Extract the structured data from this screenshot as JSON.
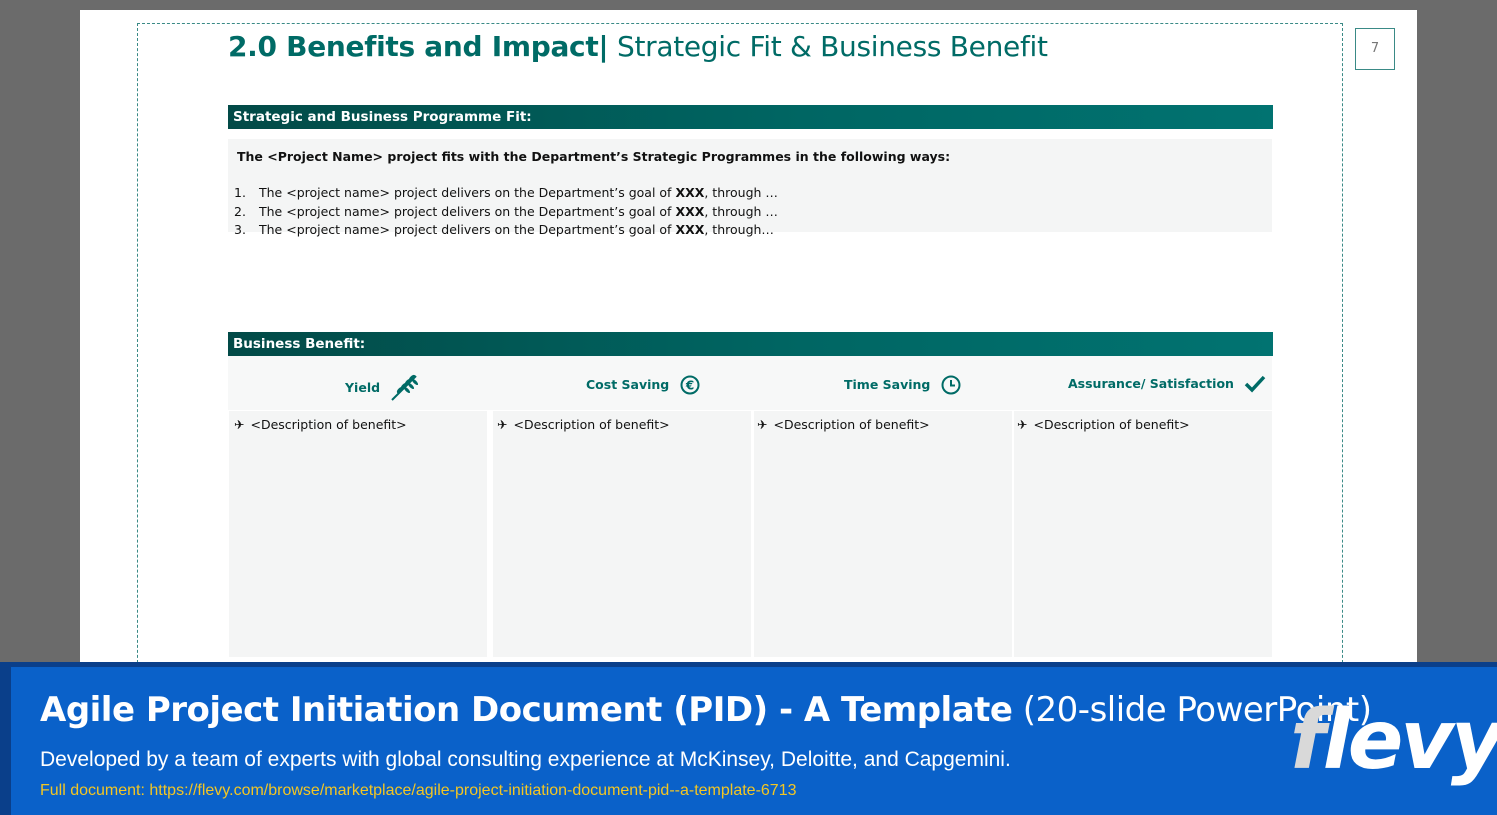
{
  "slide": {
    "page_number": "7",
    "title_bold": "2.0 Benefits and Impact",
    "title_separator": "|",
    "title_rest": "Strategic Fit & Business Benefit"
  },
  "fit_section": {
    "header": "Strategic and Business Programme Fit:",
    "intro": "The <Project Name> project fits with the Department’s Strategic Programmes in the following ways:",
    "items": [
      {
        "num": "1.",
        "prefix": "The <project name> project delivers on the Department’s goal of ",
        "goal": "XXX",
        "suffix": ", through …"
      },
      {
        "num": "2.",
        "prefix": "The <project name> project delivers on the Department’s goal of ",
        "goal": "XXX",
        "suffix": ", through …"
      },
      {
        "num": "3.",
        "prefix": "The <project name> project delivers on the Department’s goal of ",
        "goal": "XXX",
        "suffix": ", through…"
      }
    ]
  },
  "benefit_section": {
    "header": "Business Benefit:",
    "columns": [
      {
        "label": "Yield",
        "icon": "wheat-icon",
        "description": "<Description of benefit>"
      },
      {
        "label": "Cost Saving",
        "icon": "euro-icon",
        "description": "<Description of benefit>"
      },
      {
        "label": "Time Saving",
        "icon": "clock-icon",
        "description": "<Description of benefit>"
      },
      {
        "label": "Assurance/ Satisfaction",
        "icon": "checkmark-icon",
        "description": "<Description of benefit>"
      }
    ],
    "bullet_icon": "airplane-icon",
    "bullet_glyph": "✈"
  },
  "footer": {
    "title_bold": "Agile Project Initiation Document (PID) - A Template",
    "title_light": "(20-slide PowerPoint)",
    "subtitle": "Developed by a team of  experts with global consulting experience at McKinsey, Deloitte, and  Capgemini.",
    "link": "Full document: https://flevy.com/browse/marketplace/agile-project-initiation-document-pid--a-template-6713",
    "logo_first": "f",
    "logo_rest": "levy"
  },
  "colors": {
    "teal": "#006b66",
    "footer_blue": "#0a61c9",
    "link_yellow": "#f3c623"
  }
}
